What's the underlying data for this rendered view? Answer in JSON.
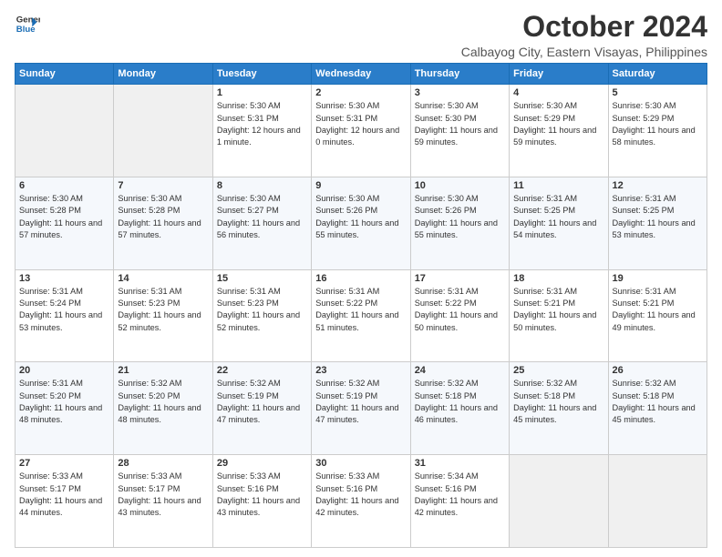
{
  "header": {
    "logo_line1": "General",
    "logo_line2": "Blue",
    "month": "October 2024",
    "location": "Calbayog City, Eastern Visayas, Philippines"
  },
  "weekdays": [
    "Sunday",
    "Monday",
    "Tuesday",
    "Wednesday",
    "Thursday",
    "Friday",
    "Saturday"
  ],
  "weeks": [
    [
      {
        "day": "",
        "sunrise": "",
        "sunset": "",
        "daylight": ""
      },
      {
        "day": "",
        "sunrise": "",
        "sunset": "",
        "daylight": ""
      },
      {
        "day": "1",
        "sunrise": "Sunrise: 5:30 AM",
        "sunset": "Sunset: 5:31 PM",
        "daylight": "Daylight: 12 hours and 1 minute."
      },
      {
        "day": "2",
        "sunrise": "Sunrise: 5:30 AM",
        "sunset": "Sunset: 5:31 PM",
        "daylight": "Daylight: 12 hours and 0 minutes."
      },
      {
        "day": "3",
        "sunrise": "Sunrise: 5:30 AM",
        "sunset": "Sunset: 5:30 PM",
        "daylight": "Daylight: 11 hours and 59 minutes."
      },
      {
        "day": "4",
        "sunrise": "Sunrise: 5:30 AM",
        "sunset": "Sunset: 5:29 PM",
        "daylight": "Daylight: 11 hours and 59 minutes."
      },
      {
        "day": "5",
        "sunrise": "Sunrise: 5:30 AM",
        "sunset": "Sunset: 5:29 PM",
        "daylight": "Daylight: 11 hours and 58 minutes."
      }
    ],
    [
      {
        "day": "6",
        "sunrise": "Sunrise: 5:30 AM",
        "sunset": "Sunset: 5:28 PM",
        "daylight": "Daylight: 11 hours and 57 minutes."
      },
      {
        "day": "7",
        "sunrise": "Sunrise: 5:30 AM",
        "sunset": "Sunset: 5:28 PM",
        "daylight": "Daylight: 11 hours and 57 minutes."
      },
      {
        "day": "8",
        "sunrise": "Sunrise: 5:30 AM",
        "sunset": "Sunset: 5:27 PM",
        "daylight": "Daylight: 11 hours and 56 minutes."
      },
      {
        "day": "9",
        "sunrise": "Sunrise: 5:30 AM",
        "sunset": "Sunset: 5:26 PM",
        "daylight": "Daylight: 11 hours and 55 minutes."
      },
      {
        "day": "10",
        "sunrise": "Sunrise: 5:30 AM",
        "sunset": "Sunset: 5:26 PM",
        "daylight": "Daylight: 11 hours and 55 minutes."
      },
      {
        "day": "11",
        "sunrise": "Sunrise: 5:31 AM",
        "sunset": "Sunset: 5:25 PM",
        "daylight": "Daylight: 11 hours and 54 minutes."
      },
      {
        "day": "12",
        "sunrise": "Sunrise: 5:31 AM",
        "sunset": "Sunset: 5:25 PM",
        "daylight": "Daylight: 11 hours and 53 minutes."
      }
    ],
    [
      {
        "day": "13",
        "sunrise": "Sunrise: 5:31 AM",
        "sunset": "Sunset: 5:24 PM",
        "daylight": "Daylight: 11 hours and 53 minutes."
      },
      {
        "day": "14",
        "sunrise": "Sunrise: 5:31 AM",
        "sunset": "Sunset: 5:23 PM",
        "daylight": "Daylight: 11 hours and 52 minutes."
      },
      {
        "day": "15",
        "sunrise": "Sunrise: 5:31 AM",
        "sunset": "Sunset: 5:23 PM",
        "daylight": "Daylight: 11 hours and 52 minutes."
      },
      {
        "day": "16",
        "sunrise": "Sunrise: 5:31 AM",
        "sunset": "Sunset: 5:22 PM",
        "daylight": "Daylight: 11 hours and 51 minutes."
      },
      {
        "day": "17",
        "sunrise": "Sunrise: 5:31 AM",
        "sunset": "Sunset: 5:22 PM",
        "daylight": "Daylight: 11 hours and 50 minutes."
      },
      {
        "day": "18",
        "sunrise": "Sunrise: 5:31 AM",
        "sunset": "Sunset: 5:21 PM",
        "daylight": "Daylight: 11 hours and 50 minutes."
      },
      {
        "day": "19",
        "sunrise": "Sunrise: 5:31 AM",
        "sunset": "Sunset: 5:21 PM",
        "daylight": "Daylight: 11 hours and 49 minutes."
      }
    ],
    [
      {
        "day": "20",
        "sunrise": "Sunrise: 5:31 AM",
        "sunset": "Sunset: 5:20 PM",
        "daylight": "Daylight: 11 hours and 48 minutes."
      },
      {
        "day": "21",
        "sunrise": "Sunrise: 5:32 AM",
        "sunset": "Sunset: 5:20 PM",
        "daylight": "Daylight: 11 hours and 48 minutes."
      },
      {
        "day": "22",
        "sunrise": "Sunrise: 5:32 AM",
        "sunset": "Sunset: 5:19 PM",
        "daylight": "Daylight: 11 hours and 47 minutes."
      },
      {
        "day": "23",
        "sunrise": "Sunrise: 5:32 AM",
        "sunset": "Sunset: 5:19 PM",
        "daylight": "Daylight: 11 hours and 47 minutes."
      },
      {
        "day": "24",
        "sunrise": "Sunrise: 5:32 AM",
        "sunset": "Sunset: 5:18 PM",
        "daylight": "Daylight: 11 hours and 46 minutes."
      },
      {
        "day": "25",
        "sunrise": "Sunrise: 5:32 AM",
        "sunset": "Sunset: 5:18 PM",
        "daylight": "Daylight: 11 hours and 45 minutes."
      },
      {
        "day": "26",
        "sunrise": "Sunrise: 5:32 AM",
        "sunset": "Sunset: 5:18 PM",
        "daylight": "Daylight: 11 hours and 45 minutes."
      }
    ],
    [
      {
        "day": "27",
        "sunrise": "Sunrise: 5:33 AM",
        "sunset": "Sunset: 5:17 PM",
        "daylight": "Daylight: 11 hours and 44 minutes."
      },
      {
        "day": "28",
        "sunrise": "Sunrise: 5:33 AM",
        "sunset": "Sunset: 5:17 PM",
        "daylight": "Daylight: 11 hours and 43 minutes."
      },
      {
        "day": "29",
        "sunrise": "Sunrise: 5:33 AM",
        "sunset": "Sunset: 5:16 PM",
        "daylight": "Daylight: 11 hours and 43 minutes."
      },
      {
        "day": "30",
        "sunrise": "Sunrise: 5:33 AM",
        "sunset": "Sunset: 5:16 PM",
        "daylight": "Daylight: 11 hours and 42 minutes."
      },
      {
        "day": "31",
        "sunrise": "Sunrise: 5:34 AM",
        "sunset": "Sunset: 5:16 PM",
        "daylight": "Daylight: 11 hours and 42 minutes."
      },
      {
        "day": "",
        "sunrise": "",
        "sunset": "",
        "daylight": ""
      },
      {
        "day": "",
        "sunrise": "",
        "sunset": "",
        "daylight": ""
      }
    ]
  ]
}
